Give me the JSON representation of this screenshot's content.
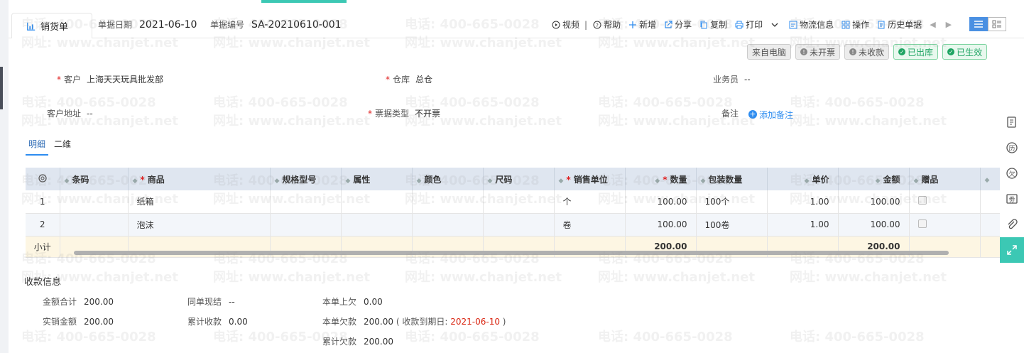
{
  "header": {
    "title": "销货单",
    "date_label": "单据日期",
    "date_value": "2021-06-10",
    "code_label": "单据编号",
    "code_value": "SA-20210610-001"
  },
  "toolbar": {
    "video": "视频",
    "help": "帮助",
    "add": "新增",
    "share": "分享",
    "copy": "复制",
    "print": "打印",
    "logistics": "物流信息",
    "operate": "操作",
    "history": "历史单据"
  },
  "badges": {
    "source": "来自电脑",
    "invoice": "未开票",
    "collect": "未收款",
    "outbound": "已出库",
    "effective": "已生效"
  },
  "form": {
    "customer_label": "客户",
    "customer_value": "上海天天玩具批发部",
    "warehouse_label": "仓库",
    "warehouse_value": "总仓",
    "salesman_label": "业务员",
    "salesman_value": "--",
    "address_label": "客户地址",
    "address_value": "--",
    "invoice_type_label": "票据类型",
    "invoice_type_value": "不开票",
    "note_label": "备注",
    "add_note": "添加备注"
  },
  "subtabs": [
    "明细",
    "二维"
  ],
  "table": {
    "columns": {
      "barcode": "条码",
      "product": "商品",
      "spec": "规格型号",
      "attr": "属性",
      "color": "颜色",
      "size": "尺码",
      "unit": "销售单位",
      "qty": "数量",
      "pack_qty": "包装数量",
      "price": "单价",
      "amount": "金额",
      "gift": "赠品"
    },
    "rows": [
      {
        "idx": "1",
        "product": "纸箱",
        "unit": "个",
        "qty": "100.00",
        "pack_qty": "100个",
        "price": "1.00",
        "amount": "100.00"
      },
      {
        "idx": "2",
        "product": "泡沫",
        "unit": "卷",
        "qty": "100.00",
        "pack_qty": "100卷",
        "price": "1.00",
        "amount": "100.00"
      }
    ],
    "subtotal": {
      "label": "小计",
      "qty": "200.00",
      "amount": "200.00"
    }
  },
  "payment": {
    "title": "收款信息",
    "total_label": "金额合计",
    "total_value": "200.00",
    "same_label": "同单现结",
    "same_value": "--",
    "prev_owe_label": "本单上欠",
    "prev_owe_value": "0.00",
    "actual_label": "实销金额",
    "actual_value": "200.00",
    "cum_recv_label": "累计收款",
    "cum_recv_value": "0.00",
    "owe_label": "本单欠款",
    "owe_value": "200.00",
    "due_prefix": "( 收款到期日:",
    "due_date": "2021-06-10",
    "due_suffix": ")",
    "cum_owe_label": "累计欠款",
    "cum_owe_value": "200.00"
  },
  "watermark": {
    "phone": "电话: 400-665-0028",
    "site": "网址: www.chanjet.net"
  },
  "colors": {
    "accent": "#3cc8b4",
    "primary": "#2d8cf0",
    "required": "#e02020",
    "success": "#1fa463"
  }
}
